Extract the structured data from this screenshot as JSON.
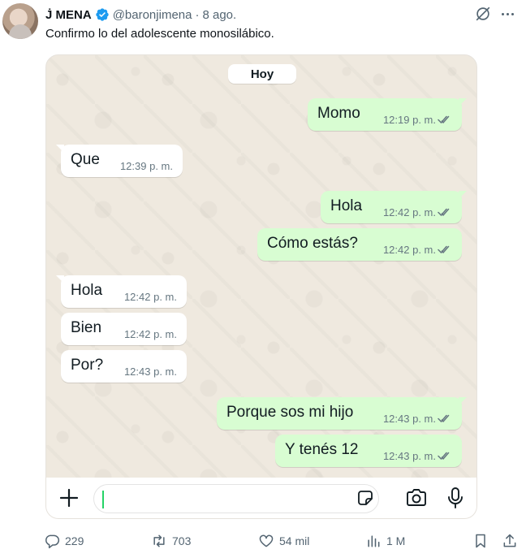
{
  "tweet": {
    "display_name": "J̇ MENA",
    "handle": "@baronjimena",
    "separator": "·",
    "date": "8 ago.",
    "text": "Confirmo lo del adolescente monosilábico.",
    "verified_color": "#1d9bf0"
  },
  "chat": {
    "day_chip": "Hoy",
    "bubble_out_color": "#d8fdd2",
    "bubble_in_color": "#ffffff",
    "messages": [
      {
        "direction": "out",
        "text": "Momo",
        "time": "12:19 p. m.",
        "status": "read"
      },
      {
        "direction": "in",
        "text": "Que",
        "time": "12:39 p. m."
      },
      {
        "direction": "out",
        "text": "Hola",
        "time": "12:42 p. m.",
        "status": "read"
      },
      {
        "direction": "out",
        "text": "Cómo estás?",
        "time": "12:42 p. m.",
        "status": "read"
      },
      {
        "direction": "in",
        "text": "Hola",
        "time": "12:42 p. m."
      },
      {
        "direction": "in",
        "text": "Bien",
        "time": "12:42 p. m."
      },
      {
        "direction": "in",
        "text": "Por?",
        "time": "12:43 p. m."
      },
      {
        "direction": "out",
        "text": "Porque sos mi hijo",
        "time": "12:43 p. m.",
        "status": "read"
      },
      {
        "direction": "out",
        "text": "Y tenés 12",
        "time": "12:43 p. m.",
        "status": "read"
      }
    ],
    "input_icons": [
      "plus-icon",
      "sticker-icon",
      "camera-icon",
      "mic-icon"
    ]
  },
  "actions": {
    "replies": "229",
    "reposts": "703",
    "likes": "54 mil",
    "views": "1 M",
    "icons": [
      "reply-icon",
      "repost-icon",
      "like-icon",
      "views-icon",
      "bookmark-icon",
      "share-icon"
    ]
  }
}
